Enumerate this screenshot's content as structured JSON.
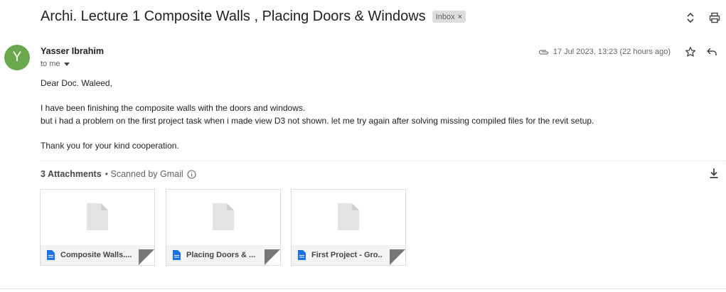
{
  "email": {
    "subject": "Archi. Lecture 1 Composite Walls , Placing Doors & Windows",
    "label": "Inbox",
    "label_close": "×",
    "sender_initial": "Y",
    "sender_name": "Yasser Ibrahim",
    "recipient": "to me",
    "date": "17 Jul 2023, 13:23 (22 hours ago)",
    "body": {
      "greeting": "Dear Doc. Waleed,",
      "line1": "I have been finishing the composite walls with the doors  and windows.",
      "line2": "but i had a problem on the first project task when i made view D3 not shown. let me try again after solving missing compiled files for the revit setup.",
      "closing": "Thank you for your kind cooperation."
    }
  },
  "attachments": {
    "count_label": "3 Attachments",
    "scanned_label": "• Scanned by Gmail",
    "items": [
      {
        "name": "Composite Walls...."
      },
      {
        "name": "Placing Doors & ..."
      },
      {
        "name": "First Project - Gro..."
      }
    ]
  },
  "colors": {
    "avatar": "#6aa84f",
    "file_icon": "#1a73e8",
    "label_chip_bg": "#dddddd"
  },
  "icons": {
    "top_actions": [
      "expand-collapse-icon",
      "print-icon"
    ],
    "meta": [
      "paperclip-icon",
      "star-icon",
      "reply-icon"
    ],
    "attachments": [
      "info-icon",
      "download-all-icon",
      "document-icon"
    ]
  }
}
